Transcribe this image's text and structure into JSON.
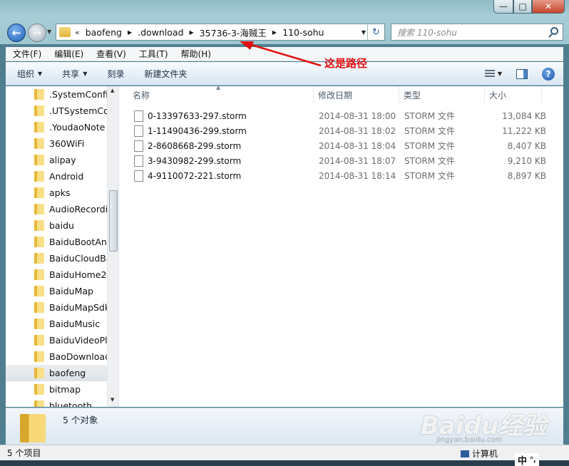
{
  "window": {
    "min_glyph": "—",
    "max_glyph": "□",
    "close_glyph": "✕"
  },
  "address": {
    "overflow": "«",
    "crumbs": [
      "baofeng",
      ".download",
      "35736-3-海贼王",
      "110-sohu"
    ],
    "refresh_glyph": "↻"
  },
  "search": {
    "placeholder": "搜索 110-sohu"
  },
  "menu": [
    "文件(F)",
    "编辑(E)",
    "查看(V)",
    "工具(T)",
    "帮助(H)"
  ],
  "commands": {
    "organize": "组织",
    "share": "共享",
    "burn": "刻录",
    "new_folder": "新建文件夹",
    "help": "?"
  },
  "nav_items": [
    ".SystemConfig",
    ".UTSystemCor",
    ".YoudaoNote",
    "360WiFi",
    "alipay",
    "Android",
    "apks",
    "AudioRecordi",
    "baidu",
    "BaiduBootAni",
    "BaiduCloudBa",
    "BaiduHome2",
    "BaiduMap",
    "BaiduMapSdk",
    "BaiduMusic",
    "BaiduVideoPla",
    "BaoDownload",
    "baofeng",
    "bitmap",
    "bluetooth"
  ],
  "nav_selected": "baofeng",
  "columns": {
    "name": "名称",
    "date": "修改日期",
    "type": "类型",
    "size": "大小"
  },
  "files": [
    {
      "name": "0-13397633-297.storm",
      "date": "2014-08-31 18:00",
      "type": "STORM 文件",
      "size": "13,084 KB"
    },
    {
      "name": "1-11490436-299.storm",
      "date": "2014-08-31 18:02",
      "type": "STORM 文件",
      "size": "11,222 KB"
    },
    {
      "name": "2-8608668-299.storm",
      "date": "2014-08-31 18:04",
      "type": "STORM 文件",
      "size": "8,407 KB"
    },
    {
      "name": "3-9430982-299.storm",
      "date": "2014-08-31 18:07",
      "type": "STORM 文件",
      "size": "9,210 KB"
    },
    {
      "name": "4-9110072-221.storm",
      "date": "2014-08-31 18:14",
      "type": "STORM 文件",
      "size": "8,897 KB"
    }
  ],
  "annotation": {
    "text": "这是路径",
    "color": "#e01010"
  },
  "details": {
    "count": "5 个对象"
  },
  "status": {
    "items": "5 个项目",
    "location": "计算机"
  },
  "ime": {
    "mode": "中",
    "punct": "°,"
  },
  "watermark": {
    "brand": "Baidu经验",
    "url": "jingyan.baidu.com"
  }
}
